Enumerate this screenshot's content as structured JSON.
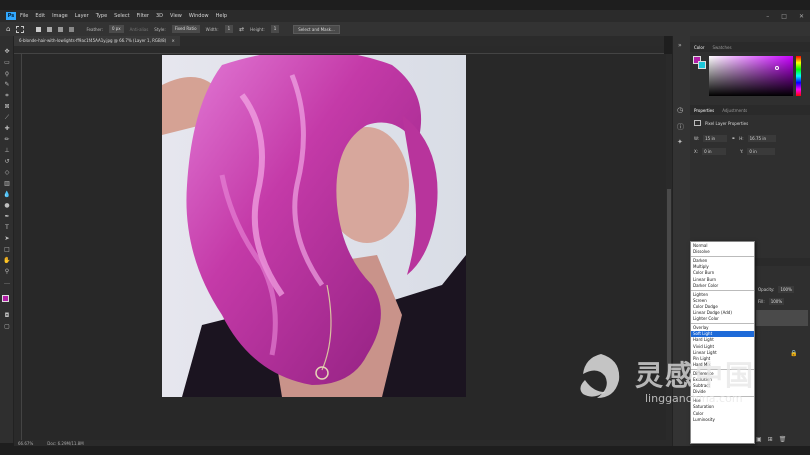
{
  "menubar": {
    "app_logo": "Ps",
    "items": [
      "File",
      "Edit",
      "Image",
      "Layer",
      "Type",
      "Select",
      "Filter",
      "3D",
      "View",
      "Window",
      "Help"
    ],
    "window_controls": [
      "–",
      "□",
      "✕"
    ]
  },
  "options_bar": {
    "feather_label": "Feather:",
    "feather_value": "0 px",
    "antialias_label": "Anti-alias",
    "style_label": "Style:",
    "style_value": "Fixed Ratio",
    "width_label": "Width:",
    "width_value": "1",
    "height_label": "Height:",
    "height_value": "1",
    "select_mask_button": "Select and Mask..."
  },
  "document_tab": {
    "title": "6-blonde-hair-with-lowlights-ff9ac1f45AA1y.jpg @ 66.7% (Layer 1, RGB/8)",
    "close": "×"
  },
  "statusbar": {
    "zoom": "66.67%",
    "doc_info": "Doc: 6.29M/11.8M"
  },
  "panels": {
    "color_tabs": [
      "Color",
      "Swatches"
    ],
    "fg_color": "#b01fa6",
    "bg_color": "#1dc7d9",
    "properties_tabs": [
      "Properties",
      "Adjustments"
    ],
    "properties_title": "Pixel Layer Properties",
    "w_label": "W:",
    "w_value": "15 in",
    "h_label": "H:",
    "h_value": "16.75 in",
    "x_label": "X:",
    "x_value": "0 in",
    "y_label": "Y:",
    "y_value": "0 in",
    "layers_opacity_label": "Opacity:",
    "layers_opacity_value": "100%",
    "layers_fill_label": "Fill:",
    "layers_fill_value": "100%"
  },
  "blend_modes": {
    "groups": [
      [
        "Normal",
        "Dissolve"
      ],
      [
        "Darken",
        "Multiply",
        "Color Burn",
        "Linear Burn",
        "Darker Color"
      ],
      [
        "Lighten",
        "Screen",
        "Color Dodge",
        "Linear Dodge (Add)",
        "Lighter Color"
      ],
      [
        "Overlay",
        "Soft Light",
        "Hard Light",
        "Vivid Light",
        "Linear Light",
        "Pin Light",
        "Hard Mix"
      ],
      [
        "Difference",
        "Exclusion",
        "Subtract",
        "Divide"
      ],
      [
        "Hue",
        "Saturation",
        "Color",
        "Luminosity"
      ]
    ],
    "selected": "Soft Light"
  },
  "watermark": {
    "chinese": "灵感中国",
    "url": "lingganchina.com"
  },
  "colors": {
    "accent_blue": "#1e6ad8",
    "ps_blue": "#31a8ff",
    "hair_pink": "#c63fb0"
  }
}
